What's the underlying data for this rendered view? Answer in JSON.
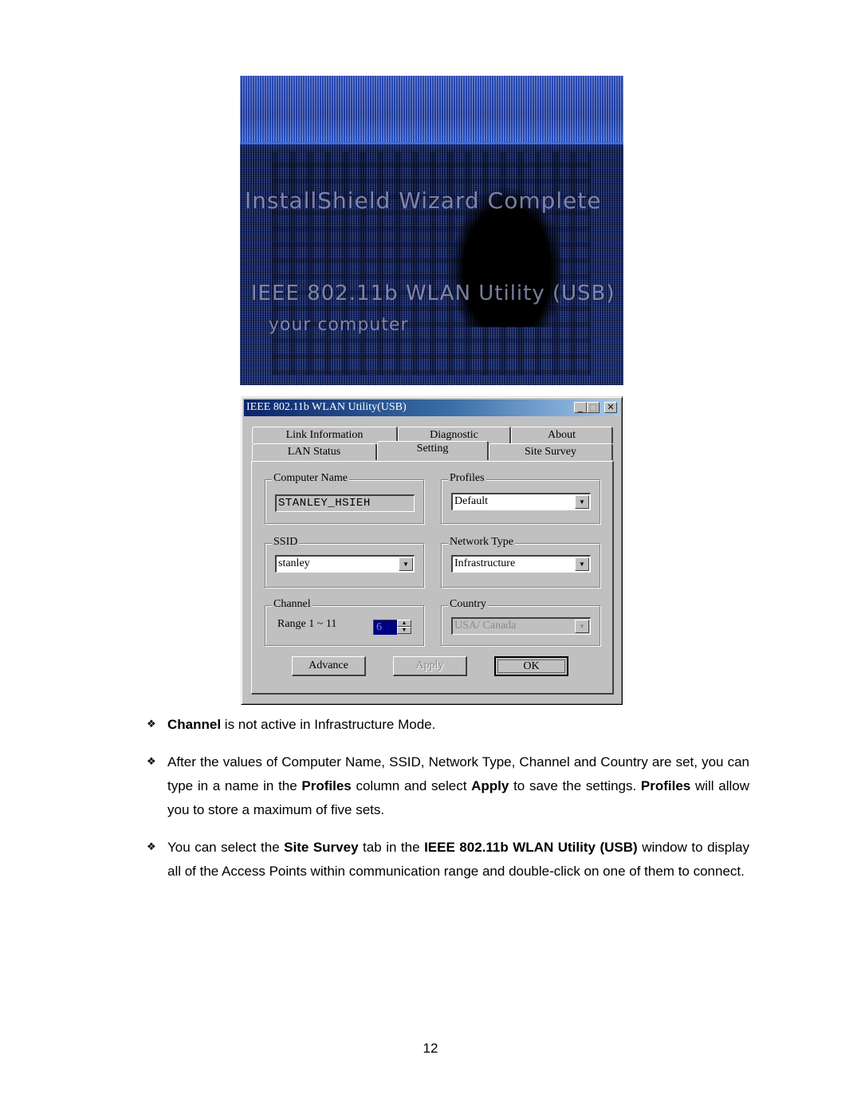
{
  "figure_top": {
    "description": "dithered installer completion screenshot (illegible)",
    "ghost_text_lines": [
      "InstallShield Wizard Complete",
      "IEEE 802.11b WLAN Utility (USB)",
      "your computer"
    ]
  },
  "dialog": {
    "title": "IEEE 802.11b WLAN Utility(USB)",
    "title_buttons": {
      "minimize": "_",
      "maximize": "□",
      "close": "✕"
    },
    "tabs_row1": [
      {
        "label": "Link Information",
        "active": false
      },
      {
        "label": "Diagnostic",
        "active": false
      },
      {
        "label": "About",
        "active": false
      }
    ],
    "tabs_row2": [
      {
        "label": "LAN Status",
        "active": false
      },
      {
        "label": "Setting",
        "active": true
      },
      {
        "label": "Site Survey",
        "active": false
      }
    ],
    "computer_name": {
      "legend": "Computer Name",
      "value": "STANLEY_HSIEH"
    },
    "profiles": {
      "legend": "Profiles",
      "value": "Default"
    },
    "ssid": {
      "legend": "SSID",
      "value": "stanley"
    },
    "network_type": {
      "legend": "Network Type",
      "value": "Infrastructure"
    },
    "channel": {
      "legend": "Channel",
      "range_label": "Range 1 ~ 11",
      "value": "6"
    },
    "country": {
      "legend": "Country",
      "value": "USA/ Canada",
      "disabled": true
    },
    "buttons": {
      "advance": "Advance",
      "apply": "Apply",
      "ok": "OK"
    },
    "icons": {
      "dropdown": "▼",
      "spin_up": "▲",
      "spin_down": "▼"
    }
  },
  "bullets": {
    "mark": "❖",
    "b1": {
      "bold1": "Channel",
      "rest": " is not active in Infrastructure Mode."
    },
    "b2": {
      "t1": "After the values of Computer Name, SSID, Network Type, Channel and Country are set, you can type in a name in the ",
      "bold1": "Profiles",
      "t2": " column and select ",
      "bold2": "Apply",
      "t3": " to save the settings. ",
      "bold3": "Profiles",
      "t4": " will allow you to store a maximum of five sets."
    },
    "b3": {
      "t1": "You can select the ",
      "bold1": "Site Survey",
      "t2": " tab in the ",
      "bold2": "IEEE 802.11b WLAN Utility (USB)",
      "t3": " window to display all of the Access Points within communication range and double-click on one of them to connect."
    }
  },
  "page_number": "12"
}
